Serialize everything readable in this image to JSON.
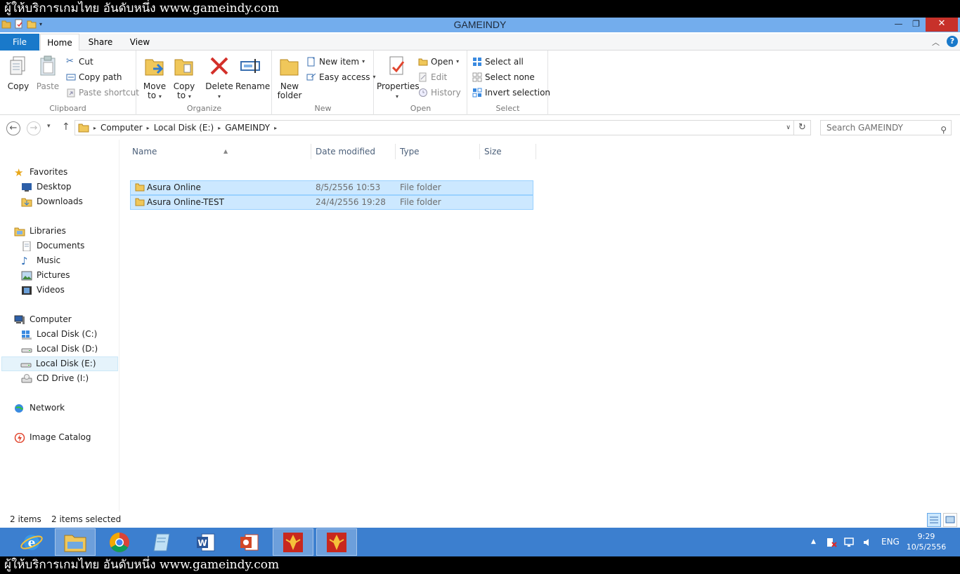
{
  "banner": {
    "top_text": "ผู้ให้บริการเกมไทย อันดับหนึ่ง www.gameindy.com",
    "bottom_text": "ผู้ให้บริการเกมไทย อันดับหนึ่ง www.gameindy.com"
  },
  "window": {
    "title": "GAMEINDY",
    "min": "—",
    "max": "❐",
    "close": "✕"
  },
  "ribbon_tabs": {
    "file": "File",
    "home": "Home",
    "share": "Share",
    "view": "View"
  },
  "ribbon": {
    "clipboard": {
      "label": "Clipboard",
      "copy": "Copy",
      "paste": "Paste",
      "cut": "Cut",
      "copy_path": "Copy path",
      "paste_shortcut": "Paste shortcut"
    },
    "organize": {
      "label": "Organize",
      "move_to_1": "Move",
      "move_to_2": "to",
      "copy_to_1": "Copy",
      "copy_to_2": "to",
      "delete": "Delete",
      "rename": "Rename"
    },
    "new": {
      "label": "New",
      "new_folder_1": "New",
      "new_folder_2": "folder",
      "new_item": "New item",
      "easy_access": "Easy access"
    },
    "open": {
      "label": "Open",
      "properties": "Properties",
      "open": "Open",
      "edit": "Edit",
      "history": "History"
    },
    "select": {
      "label": "Select",
      "select_all": "Select all",
      "select_none": "Select none",
      "invert": "Invert selection"
    }
  },
  "address": {
    "crumbs": [
      "Computer",
      "Local Disk (E:)",
      "GAMEINDY"
    ],
    "search_placeholder": "Search GAMEINDY"
  },
  "navpane": {
    "favorites": "Favorites",
    "desktop": "Desktop",
    "downloads": "Downloads",
    "libraries": "Libraries",
    "documents": "Documents",
    "music": "Music",
    "pictures": "Pictures",
    "videos": "Videos",
    "computer": "Computer",
    "disk_c": "Local Disk (C:)",
    "disk_d": "Local Disk (D:)",
    "disk_e": "Local Disk (E:)",
    "cd_drive": "CD Drive (I:)",
    "network": "Network",
    "image_catalog": "Image Catalog"
  },
  "columns": {
    "name": "Name",
    "date": "Date modified",
    "type": "Type",
    "size": "Size"
  },
  "files": [
    {
      "name": "Asura Online",
      "date": "8/5/2556 10:53",
      "type": "File folder"
    },
    {
      "name": "Asura Online-TEST",
      "date": "24/4/2556 19:28",
      "type": "File folder"
    }
  ],
  "status": {
    "count": "2 items",
    "selected": "2 items selected"
  },
  "tray": {
    "lang": "ENG",
    "time": "9:29",
    "date": "10/5/2556"
  },
  "colors": {
    "accent": "#1979ca",
    "titlebar": "#73aded",
    "selection": "#cce8ff",
    "taskbar": "#3c7fcf"
  }
}
